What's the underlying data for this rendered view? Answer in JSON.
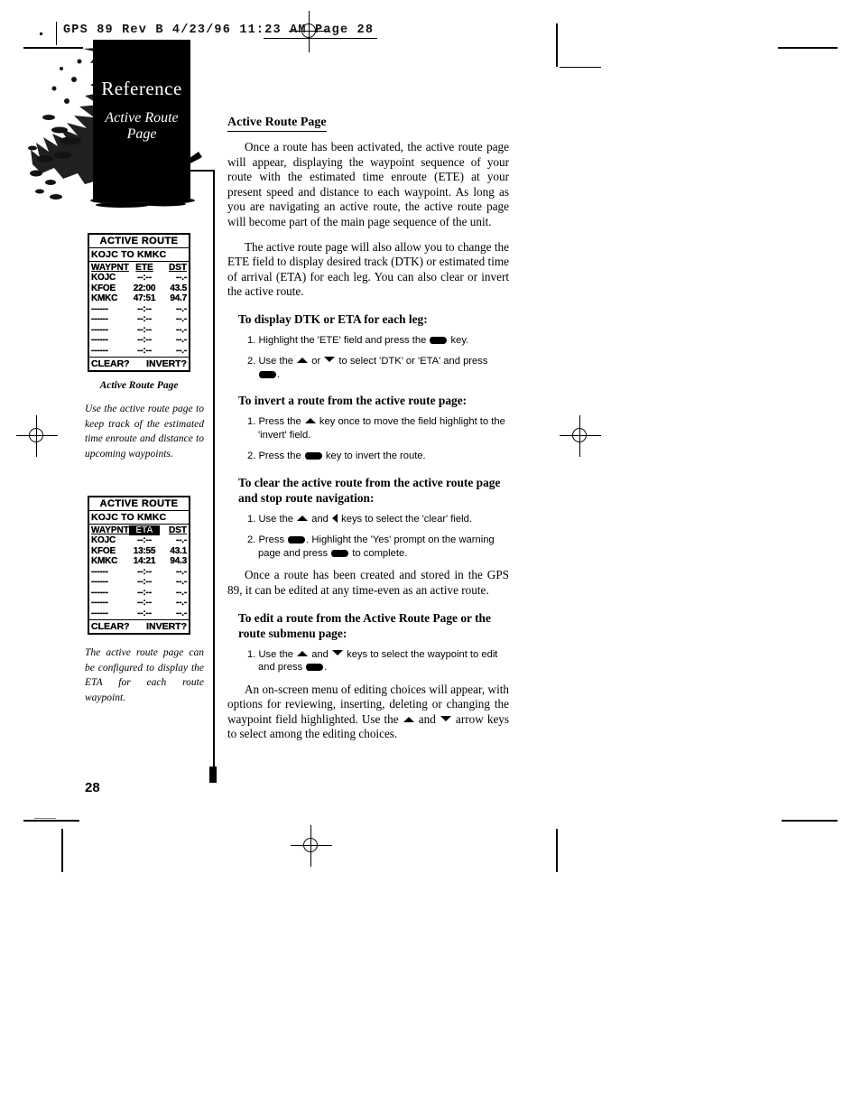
{
  "running_head": "GPS 89  Rev B   4/23/96 11:23 AM   Page 28",
  "folio": "28",
  "tab": {
    "chapter": "Reference",
    "subtitle_line1": "Active Route",
    "subtitle_line2": "Page"
  },
  "main": {
    "heading": "Active Route Page",
    "paragraph_1": "Once a route has been activated, the active route page will appear, displaying the waypoint sequence of your route with the estimated time enroute (ETE) at your present speed and distance to each waypoint. As long as you are navigating an active route, the active route page will become part of the main page sequence of the unit.",
    "paragraph_2": "The active route page will also allow you to change the ETE field to display desired track (DTK) or estimated time of arrival (ETA) for each leg. You can also clear or invert the active route.",
    "procedure_1": {
      "heading": "To display DTK or ETA for each leg:",
      "steps": [
        {
          "num": "1.",
          "pre": "Highlight the 'ETE' field and press the ",
          "icons": [
            "key"
          ],
          "post": " key."
        },
        {
          "num": "2.",
          "pre": "Use the ",
          "icons": [
            "arw-up",
            "or",
            "arw-down"
          ],
          "mid": " to select 'DTK' or 'ETA' and press ",
          "post": "."
        }
      ]
    },
    "procedure_2": {
      "heading": "To invert a route from the active route page:",
      "steps": [
        {
          "num": "1.",
          "pre": "Press the ",
          "post": " key once to move the field highlight to the 'invert' field."
        },
        {
          "num": "2.",
          "pre": "Press the ",
          "post": " key to invert the route."
        }
      ]
    },
    "procedure_3": {
      "heading": "To clear the active route from the active route page and stop route navigation:",
      "steps": [
        {
          "num": "1.",
          "pre": "Use the ",
          "post": " keys to select the 'clear' field."
        },
        {
          "num": "2.",
          "pre": "Press ",
          "mid": ". Highlight the 'Yes' prompt on the warning page and press ",
          "post": " to complete."
        }
      ]
    },
    "paragraph_3": "Once a route has been created and stored in the GPS 89, it can be edited at any time-even as an active route.",
    "procedure_4": {
      "heading": "To edit a route from the Active Route Page or the route submenu page:",
      "steps": [
        {
          "num": "1.",
          "pre": "Use the ",
          "post": " keys to select the waypoint to edit and press "
        }
      ]
    },
    "paragraph_4": "An on-screen menu of editing choices will appear, with options for reviewing, inserting, deleting or changing the waypoint field highlighted. Use the",
    "paragraph_4b": "and",
    "paragraph_4c": "arrow keys to select among the editing choices."
  },
  "figures": [
    {
      "screen": {
        "title": "ACTIVE ROUTE",
        "route": "KOJC TO KMKC",
        "columns": [
          "WAYPNT",
          "ETE",
          "DST"
        ],
        "highlighted_column": null,
        "rows": [
          {
            "waypoint": "KOJC",
            "value": "--:--",
            "dst": "--.-"
          },
          {
            "waypoint": "KFOE",
            "value": "22:00",
            "dst": "43.5"
          },
          {
            "waypoint": "KMKC",
            "value": "47:51",
            "dst": "94.7"
          },
          {
            "waypoint": "------",
            "value": "--:--",
            "dst": "--.-"
          },
          {
            "waypoint": "------",
            "value": "--:--",
            "dst": "--.-"
          },
          {
            "waypoint": "------",
            "value": "--:--",
            "dst": "--.-"
          },
          {
            "waypoint": "------",
            "value": "--:--",
            "dst": "--.-"
          },
          {
            "waypoint": "------",
            "value": "--:--",
            "dst": "--.-"
          }
        ],
        "footer_left": "CLEAR?",
        "footer_right": "INVERT?"
      },
      "caption_title": "Active Route Page",
      "caption_body": "Use the active route page to keep track of the estimated time enroute and distance to upcoming waypoints."
    },
    {
      "screen": {
        "title": "ACTIVE ROUTE",
        "route": "KOJC TO KMKC",
        "columns": [
          "WAYPNT",
          "ETA",
          "DST"
        ],
        "highlighted_column": "ETA",
        "rows": [
          {
            "waypoint": "KOJC",
            "value": "--:--",
            "dst": "--.-"
          },
          {
            "waypoint": "KFOE",
            "value": "13:55",
            "dst": "43.1"
          },
          {
            "waypoint": "KMKC",
            "value": "14:21",
            "dst": "94.3"
          },
          {
            "waypoint": "------",
            "value": "--:--",
            "dst": "--.-"
          },
          {
            "waypoint": "------",
            "value": "--:--",
            "dst": "--.-"
          },
          {
            "waypoint": "------",
            "value": "--:--",
            "dst": "--.-"
          },
          {
            "waypoint": "------",
            "value": "--:--",
            "dst": "--.-"
          },
          {
            "waypoint": "------",
            "value": "--:--",
            "dst": "--.-"
          }
        ],
        "footer_left": "CLEAR?",
        "footer_right": "INVERT?"
      },
      "caption_title": "",
      "caption_body": "The active route page can be configured to display the ETA for each route waypoint."
    }
  ]
}
